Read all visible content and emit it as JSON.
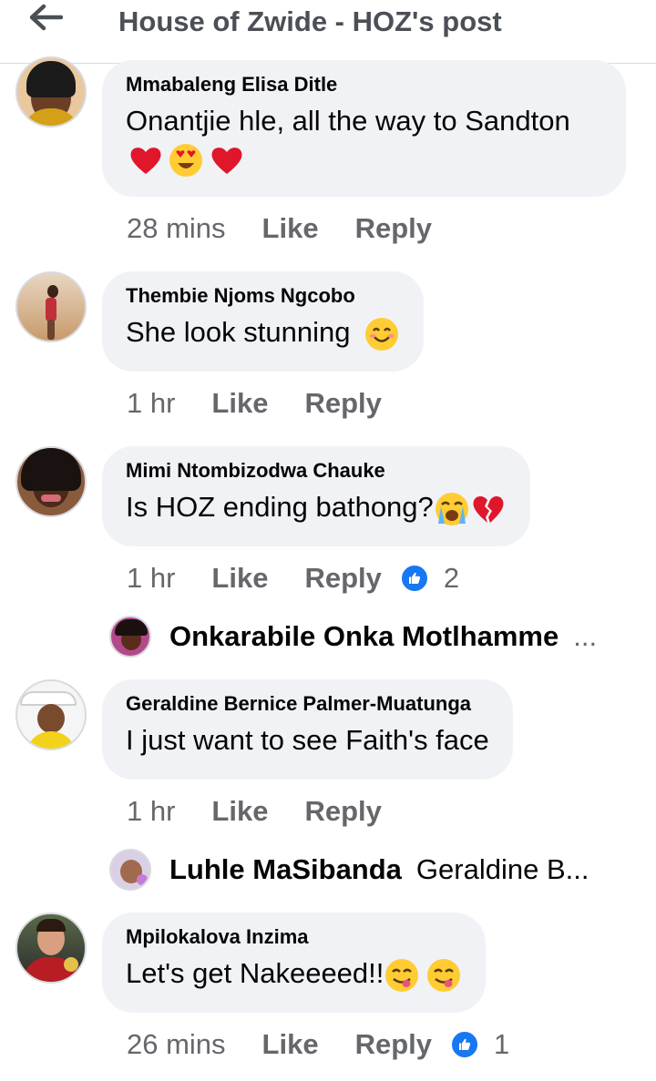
{
  "header": {
    "title": "House of Zwide - HOZ's post"
  },
  "comments": [
    {
      "author": "Mmabaleng Elisa Ditle",
      "text": "Onantjie hle, all the way to Sandton",
      "time": "28 mins",
      "like_label": "Like",
      "reply_label": "Reply"
    },
    {
      "author": "Thembie Njoms Ngcobo",
      "text": "She look stunning",
      "time": "1 hr",
      "like_label": "Like",
      "reply_label": "Reply"
    },
    {
      "author": "Mimi Ntombizodwa Chauke",
      "text": "Is HOZ ending bathong?",
      "time": "1 hr",
      "like_label": "Like",
      "reply_label": "Reply",
      "reaction_count": "2",
      "reply_preview": {
        "name": "Onkarabile Onka Motlhamme",
        "snippet": "..."
      }
    },
    {
      "author": "Geraldine Bernice Palmer-Muatunga",
      "text": "I just want to see Faith's face",
      "time": "1 hr",
      "like_label": "Like",
      "reply_label": "Reply",
      "reply_preview": {
        "name": "Luhle MaSibanda",
        "snippet": "Geraldine B..."
      }
    },
    {
      "author": "Mpilokalova Inzima",
      "text": "Let's get Nakeeeed!!",
      "time": "26 mins",
      "like_label": "Like",
      "reply_label": "Reply",
      "reaction_count": "1"
    }
  ],
  "icons": {
    "back": "arrow-left-icon",
    "like_reaction": "thumbs-up-icon",
    "emoji_heart": "red-heart-emoji",
    "emoji_heart_eyes": "heart-eyes-emoji",
    "emoji_smile": "smiling-face-emoji",
    "emoji_crying": "loudly-crying-emoji",
    "emoji_broken_heart": "broken-heart-emoji",
    "emoji_yum": "face-savoring-food-emoji"
  },
  "colors": {
    "accent": "#1877f2",
    "bubble": "#f0f2f5",
    "secondary_text": "#65676b",
    "header_text": "#4b4f56"
  }
}
